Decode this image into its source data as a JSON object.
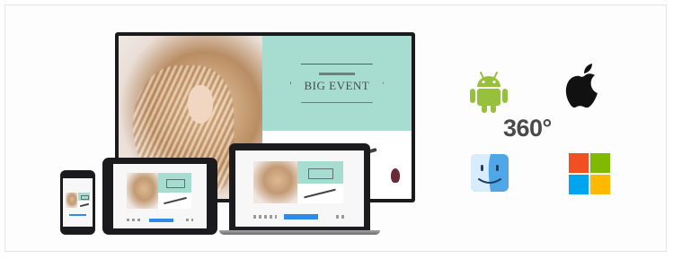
{
  "banner": {
    "event_title": "BIG EVENT",
    "label_360": "360°"
  },
  "platform_icons": [
    "android-icon",
    "apple-icon",
    "finder-icon",
    "windows-icon"
  ],
  "colors": {
    "mint": "#a6ddd0",
    "android_green": "#97c03d",
    "windows_red": "#f25022",
    "windows_green": "#7fba00",
    "windows_blue": "#00a4ef",
    "windows_yellow": "#ffb900",
    "accent_blue": "#2d8ce8"
  }
}
